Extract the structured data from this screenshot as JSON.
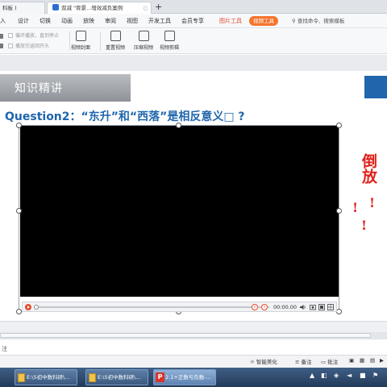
{
  "tabs": [
    {
      "label": "科板 )"
    },
    {
      "label": "双减 \"背景...增效减负案例"
    }
  ],
  "menubar": {
    "items": [
      "入",
      "设计",
      "切换",
      "动画",
      "放映",
      "审阅",
      "视图",
      "开发工具",
      "会员专享",
      "图片工具"
    ],
    "active_pill": "视频工具",
    "search": "查找命令、搜索模板"
  },
  "ribbon": {
    "checkbox_1": "循环播放，直到停止",
    "checkbox_2": "播放完返回开头",
    "buttons": [
      "视频封面",
      "重置视频",
      "压缩视频",
      "视频剪辑"
    ]
  },
  "slide": {
    "banner_title": "知识精讲",
    "question": "Question2：“东升”和“西落”是相反意义□ ?",
    "side_text": "倒放",
    "exclamations": [
      "!",
      "!",
      "!"
    ]
  },
  "video": {
    "time": "00:00.00"
  },
  "notes": {
    "label": "注"
  },
  "status": {
    "smart": "智能美化",
    "notes": "备注",
    "comments": "批注"
  },
  "taskbar": {
    "tasks": [
      "E:\\5初中数科研\\...",
      "E:\\5初中数科研\\...",
      "2.1+正数与负数-..."
    ]
  },
  "colors": {
    "accent_blue": "#1f66ad",
    "accent_orange": "#f4752e",
    "alert_red": "#e0201a"
  }
}
